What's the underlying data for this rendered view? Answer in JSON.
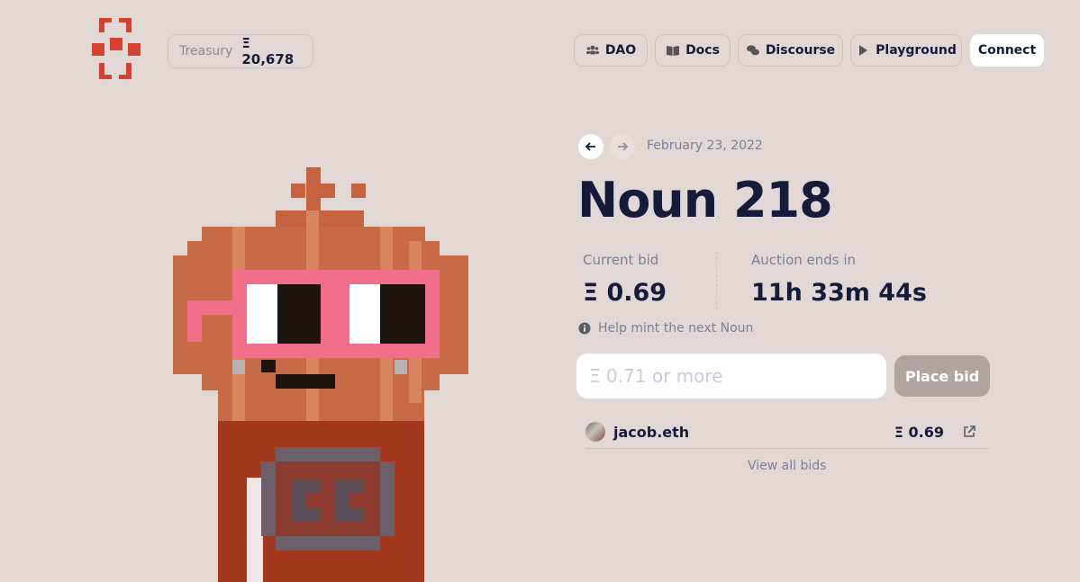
{
  "header": {
    "treasury_label": "Treasury",
    "treasury_value": "Ξ 20,678",
    "nav": [
      {
        "label": "DAO",
        "icon": "users-icon"
      },
      {
        "label": "Docs",
        "icon": "book-icon"
      },
      {
        "label": "Discourse",
        "icon": "comments-icon"
      },
      {
        "label": "Playground",
        "icon": "play-icon"
      }
    ],
    "connect_label": "Connect"
  },
  "auction": {
    "date": "February 23, 2022",
    "title": "Noun 218",
    "current_bid_label": "Current bid",
    "current_bid_value": "Ξ 0.69",
    "ends_label": "Auction ends in",
    "ends_value": "11h 33m 44s",
    "help_text": "Help mint the next Noun",
    "bid_placeholder": "Ξ 0.71 or more",
    "place_bid_label": "Place bid",
    "bids": [
      {
        "bidder": "jacob.eth",
        "amount": "Ξ 0.69"
      }
    ],
    "view_all_label": "View all bids"
  },
  "colors": {
    "background": "#e1d7d5",
    "text": "#151c3b",
    "muted": "#79809c",
    "logo_red": "#d4412f"
  }
}
